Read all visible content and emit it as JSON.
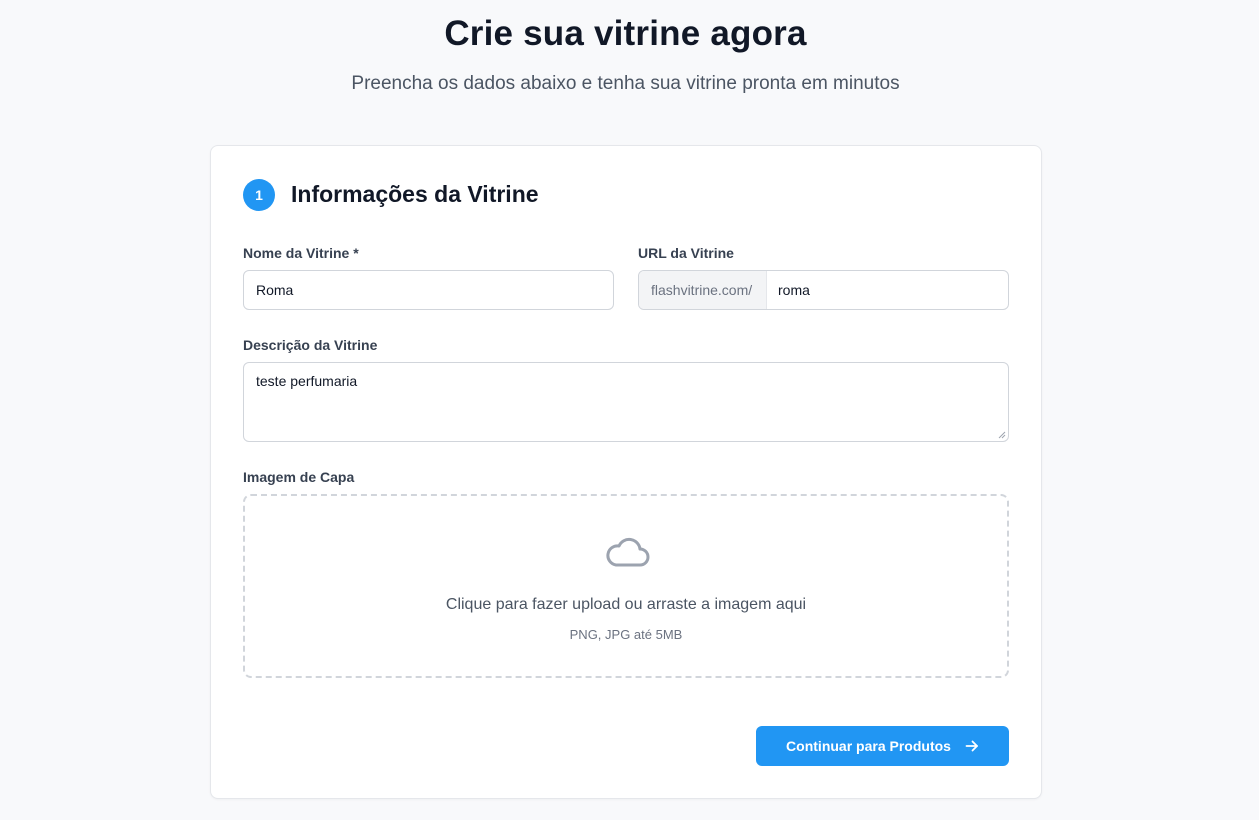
{
  "header": {
    "title": "Crie sua vitrine agora",
    "subtitle": "Preencha os dados abaixo e tenha sua vitrine pronta em minutos"
  },
  "section": {
    "step_number": "1",
    "title": "Informações da Vitrine"
  },
  "form": {
    "name": {
      "label": "Nome da Vitrine *",
      "value": "Roma"
    },
    "url": {
      "label": "URL da Vitrine",
      "prefix": "flashvitrine.com/",
      "value": "roma"
    },
    "description": {
      "label": "Descrição da Vitrine",
      "value": "teste perfumaria"
    },
    "cover_image": {
      "label": "Imagem de Capa",
      "upload_text": "Clique para fazer upload ou arraste a imagem aqui",
      "upload_hint": "PNG, JPG até 5MB",
      "icon": "cloud-upload-icon"
    }
  },
  "actions": {
    "continue_label": "Continuar para Produtos",
    "continue_icon": "arrow-right-icon"
  },
  "colors": {
    "accent": "#2196f3",
    "background": "#f8f9fb",
    "title": "#111827"
  }
}
